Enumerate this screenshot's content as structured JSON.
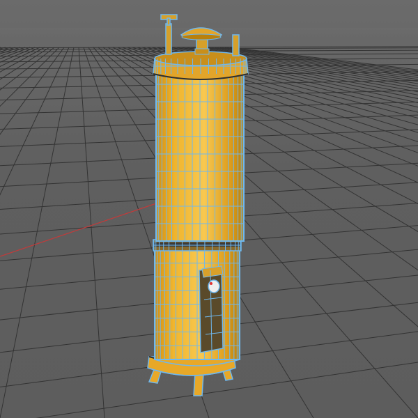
{
  "viewport": {
    "mode": "perspective",
    "display": "wireframe-on-shaded",
    "background_color": "#626262",
    "grid_color": "#333333",
    "grid_visible": true,
    "x_axis_color": "#c23a3a"
  },
  "model": {
    "name": "water-heater",
    "body_color": "#f0b52d",
    "wire_color": "#6fb8ee",
    "parts": [
      "top-cap",
      "upper-tank",
      "middle-band",
      "lower-tank",
      "control-panel",
      "dial",
      "base-ring",
      "legs",
      "chimney",
      "pipes"
    ]
  }
}
